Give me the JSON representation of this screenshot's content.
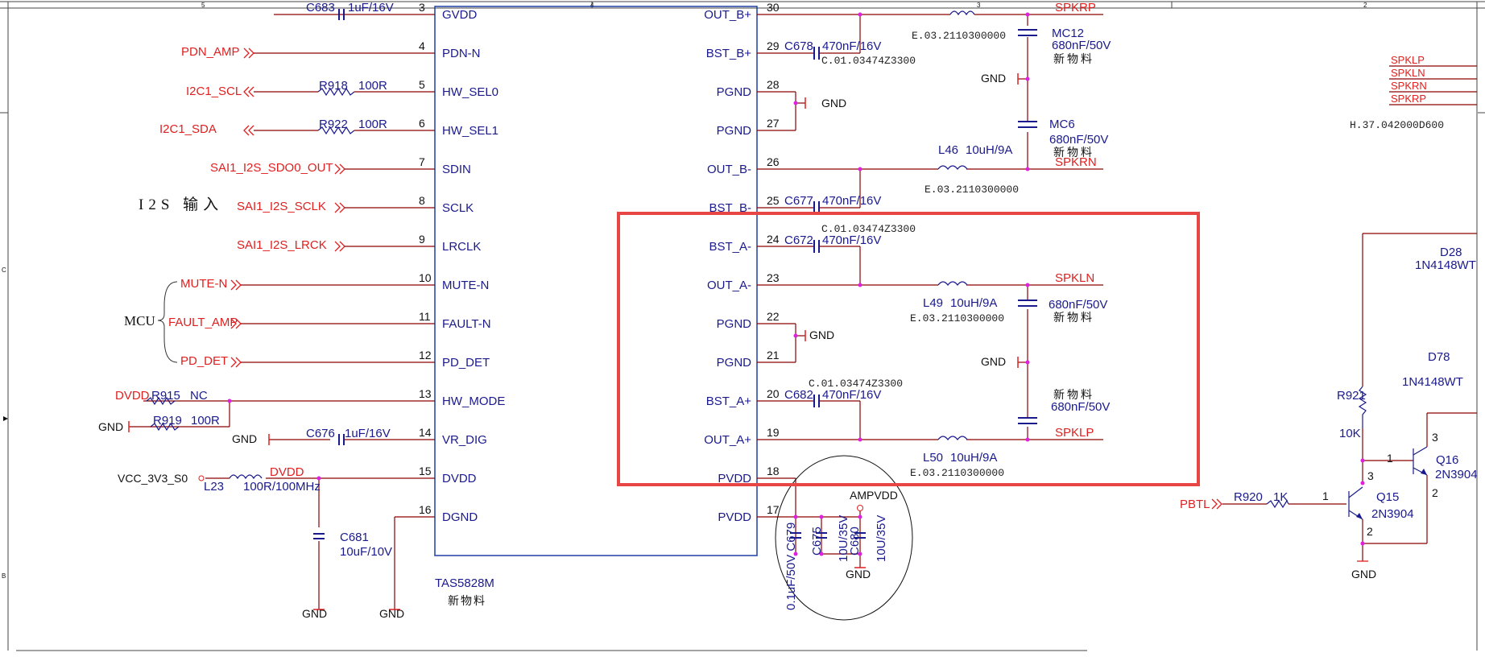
{
  "title_block": {
    "col_5": "5",
    "col_4": "4",
    "col_3": "3",
    "col_2": "2",
    "row_c": "C",
    "row_b": "B"
  },
  "ic": {
    "part": "TAS5828M",
    "note": "新物料"
  },
  "left_pins": [
    {
      "num": "3",
      "name": "GVDD",
      "net": "",
      "part": "C683",
      "value": "1uF/16V"
    },
    {
      "num": "4",
      "name": "PDN-N",
      "net": "PDN_AMP"
    },
    {
      "num": "5",
      "name": "HW_SEL0",
      "net": "I2C1_SCL",
      "part": "R918",
      "value": "100R"
    },
    {
      "num": "6",
      "name": "HW_SEL1",
      "net": "I2C1_SDA",
      "part": "R922",
      "value": "100R"
    },
    {
      "num": "7",
      "name": "SDIN",
      "net": "SAI1_I2S_SDO0_OUT"
    },
    {
      "num": "8",
      "name": "SCLK",
      "net": "SAI1_I2S_SCLK"
    },
    {
      "num": "9",
      "name": "LRCLK",
      "net": "SAI1_I2S_LRCK"
    },
    {
      "num": "10",
      "name": "MUTE-N",
      "net": "MUTE-N"
    },
    {
      "num": "11",
      "name": "FAULT-N",
      "net": "FAULT_AMP"
    },
    {
      "num": "12",
      "name": "PD_DET",
      "net": "PD_DET"
    },
    {
      "num": "13",
      "name": "HW_MODE",
      "net": "DVDD"
    },
    {
      "num": "14",
      "name": "VR_DIG",
      "net": "GND"
    },
    {
      "num": "15",
      "name": "DVDD",
      "net": "VCC_3V3_S0"
    },
    {
      "num": "16",
      "name": "DGND",
      "net": "GND"
    }
  ],
  "right_pins": [
    {
      "num": "30",
      "name": "OUT_B+"
    },
    {
      "num": "29",
      "name": "BST_B+"
    },
    {
      "num": "28",
      "name": "PGND"
    },
    {
      "num": "27",
      "name": "PGND"
    },
    {
      "num": "26",
      "name": "OUT_B-"
    },
    {
      "num": "25",
      "name": "BST_B-"
    },
    {
      "num": "24",
      "name": "BST_A-"
    },
    {
      "num": "23",
      "name": "OUT_A-"
    },
    {
      "num": "22",
      "name": "PGND"
    },
    {
      "num": "21",
      "name": "PGND"
    },
    {
      "num": "20",
      "name": "BST_A+"
    },
    {
      "num": "19",
      "name": "OUT_A+"
    },
    {
      "num": "18",
      "name": "PVDD"
    },
    {
      "num": "17",
      "name": "PVDD"
    }
  ],
  "labels": {
    "i2s_input": "I2S 输入",
    "mcu": "MCU",
    "gnd": "GND",
    "nc": "NC",
    "dvdd": "DVDD",
    "ampvdd": "AMPVDD",
    "r915": "R915",
    "r919": "R919",
    "r919_val": "100R",
    "c676": "C676",
    "c676_val": "1uF/16V",
    "l23": "L23",
    "l23_val": "100R/100MHz",
    "c681": "C681",
    "c681_val": "10uF/10V",
    "c678": "C678",
    "c678_val": "470nF/16V",
    "c678_code": "C.01.03474Z3300",
    "c677": "C677",
    "c677_val": "470nF/16V",
    "c677_code": "C.01.03474Z3300",
    "c672": "C672",
    "c672_val": "470nF/16V",
    "c682": "C682",
    "c682_val": "470nF/16V",
    "c682_code": "C.01.03474Z3300",
    "mc12": "MC12",
    "mc12_val": "680nF/50V",
    "mc12_note": "新物料",
    "mc6": "MC6",
    "mc6_val": "680nF/50V",
    "mc6_note": "新物料",
    "cap_a_val": "680nF/50V",
    "cap_a_note": "新物料",
    "cap_b_val": "680nF/50V",
    "cap_b_note": "新物料",
    "e_code_1": "E.03.2110300000",
    "e_code_2": "E.03.2110300000",
    "e_code_3": "E.03.2110300000",
    "e_code_4": "E.03.2110300000",
    "l46": "L46",
    "l46_val": "10uH/9A",
    "l49": "L49",
    "l49_val": "10uH/9A",
    "l50": "L50",
    "l50_val": "10uH/9A",
    "spkrp": "SPKRP",
    "spkrn": "SPKRN",
    "spkln": "SPKLN",
    "spklp": "SPKLP",
    "c679_text": "0.1uF/50V C679",
    "c675": "C675",
    "c675_val": "10U/35V",
    "c680": "C680",
    "c680_val": "10U/35V",
    "conn_spklp": "SPKLP",
    "conn_spkln": "SPKLN",
    "conn_spkrn": "SPKRN",
    "conn_spkrp": "SPKRP",
    "h_code": "H.37.042000D600",
    "d28": "D28",
    "d28_val": "1N4148WT",
    "d78": "D78",
    "d78_val": "1N4148WT",
    "r921": "R921",
    "r921_val": "10K",
    "q16": "Q16",
    "q16_val": "2N3904",
    "q15": "Q15",
    "q15_val": "2N3904",
    "r920": "R920",
    "r920_val": "1K",
    "pbtl": "PBTL",
    "pin_1a": "1",
    "pin_3a": "3",
    "pin_2a": "2",
    "pin_1b": "1",
    "pin_3b": "3",
    "pin_2b": "2"
  },
  "highlight": {
    "color": "#e84545"
  },
  "colors": {
    "net_red": "#e02020",
    "wire_dark": "#8b0000",
    "component_blue": "#1a1a8c",
    "junction": "#e01fe0",
    "box_blue": "#1f3ea6"
  }
}
